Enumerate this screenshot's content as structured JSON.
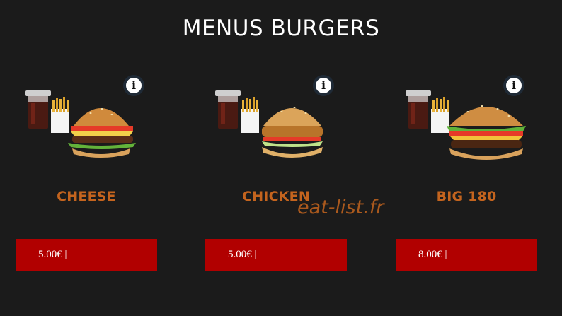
{
  "page": {
    "title": "MENUS BURGERS"
  },
  "menus": [
    {
      "name": "CHEESE",
      "price": "5.00€ |"
    },
    {
      "name": "CHICKEN",
      "price": "5.00€ |"
    },
    {
      "name": "BIG 180",
      "price": "8.00€ |"
    }
  ],
  "info_glyph": "i",
  "watermark": "eat-list.fr",
  "colors": {
    "accent": "#c4641e",
    "button": "#b10000",
    "background": "#1b1b1b"
  }
}
